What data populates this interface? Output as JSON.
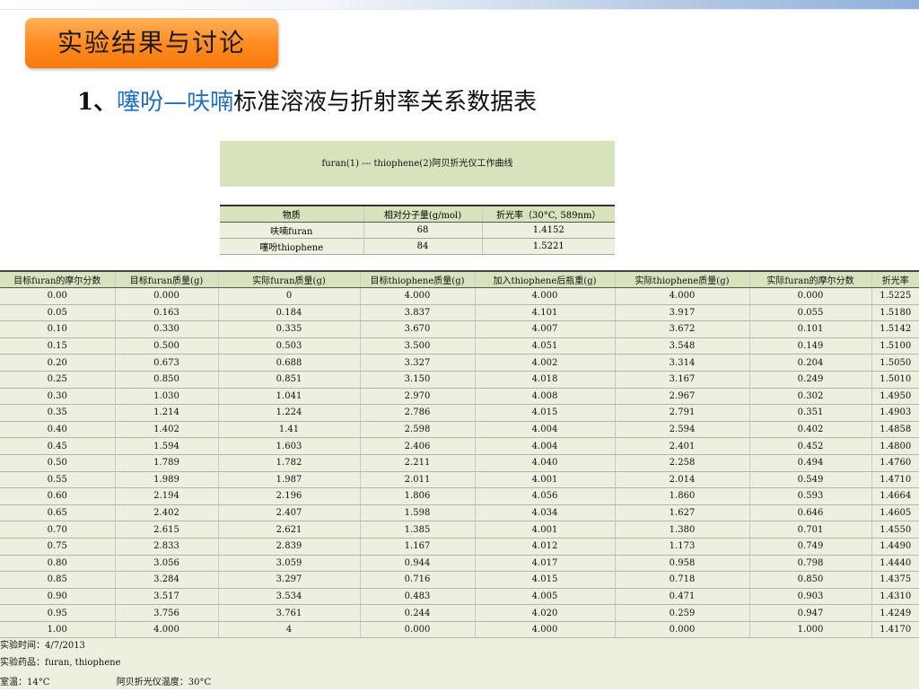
{
  "section_title": "实验结果与讨论",
  "subtitle": {
    "number": "1、",
    "compound_a": "噻吩",
    "dash": "—",
    "compound_b": "呋喃",
    "rest": "标准溶液与折射率关系数据表"
  },
  "curve_title": "furan(1) --- thiophene(2)阿贝折光仪工作曲线",
  "mw_table": {
    "headers": [
      "物质",
      "相对分子量(g/mol)",
      "折光率（30°C, 589nm）"
    ],
    "rows": [
      [
        "呋喃furan",
        "68",
        "1.4152"
      ],
      [
        "噻吩thiophene",
        "84",
        "1.5221"
      ]
    ]
  },
  "data_table": {
    "headers": [
      "目标furan的摩尔分数",
      "目标furan质量(g)",
      "实际furan质量(g)",
      "目标thiophene质量(g)",
      "加入thiophene后瓶重(g)",
      "实际thiophene质量(g)",
      "实际furan的摩尔分数",
      "折光率"
    ],
    "rows": [
      [
        "0.00",
        "0.000",
        "0",
        "4.000",
        "4.000",
        "4.000",
        "0.000",
        "1.5225"
      ],
      [
        "0.05",
        "0.163",
        "0.184",
        "3.837",
        "4.101",
        "3.917",
        "0.055",
        "1.5180"
      ],
      [
        "0.10",
        "0.330",
        "0.335",
        "3.670",
        "4.007",
        "3.672",
        "0.101",
        "1.5142"
      ],
      [
        "0.15",
        "0.500",
        "0.503",
        "3.500",
        "4.051",
        "3.548",
        "0.149",
        "1.5100"
      ],
      [
        "0.20",
        "0.673",
        "0.688",
        "3.327",
        "4.002",
        "3.314",
        "0.204",
        "1.5050"
      ],
      [
        "0.25",
        "0.850",
        "0.851",
        "3.150",
        "4.018",
        "3.167",
        "0.249",
        "1.5010"
      ],
      [
        "0.30",
        "1.030",
        "1.041",
        "2.970",
        "4.008",
        "2.967",
        "0.302",
        "1.4950"
      ],
      [
        "0.35",
        "1.214",
        "1.224",
        "2.786",
        "4.015",
        "2.791",
        "0.351",
        "1.4903"
      ],
      [
        "0.40",
        "1.402",
        "1.41",
        "2.598",
        "4.004",
        "2.594",
        "0.402",
        "1.4858"
      ],
      [
        "0.45",
        "1.594",
        "1.603",
        "2.406",
        "4.004",
        "2.401",
        "0.452",
        "1.4800"
      ],
      [
        "0.50",
        "1.789",
        "1.782",
        "2.211",
        "4.040",
        "2.258",
        "0.494",
        "1.4760"
      ],
      [
        "0.55",
        "1.989",
        "1.987",
        "2.011",
        "4.001",
        "2.014",
        "0.549",
        "1.4710"
      ],
      [
        "0.60",
        "2.194",
        "2.196",
        "1.806",
        "4.056",
        "1.860",
        "0.593",
        "1.4664"
      ],
      [
        "0.65",
        "2.402",
        "2.407",
        "1.598",
        "4.034",
        "1.627",
        "0.646",
        "1.4605"
      ],
      [
        "0.70",
        "2.615",
        "2.621",
        "1.385",
        "4.001",
        "1.380",
        "0.701",
        "1.4550"
      ],
      [
        "0.75",
        "2.833",
        "2.839",
        "1.167",
        "4.012",
        "1.173",
        "0.749",
        "1.4490"
      ],
      [
        "0.80",
        "3.056",
        "3.059",
        "0.944",
        "4.017",
        "0.958",
        "0.798",
        "1.4440"
      ],
      [
        "0.85",
        "3.284",
        "3.297",
        "0.716",
        "4.015",
        "0.718",
        "0.850",
        "1.4375"
      ],
      [
        "0.90",
        "3.517",
        "3.534",
        "0.483",
        "4.005",
        "0.471",
        "0.903",
        "1.4310"
      ],
      [
        "0.95",
        "3.756",
        "3.761",
        "0.244",
        "4.020",
        "0.259",
        "0.947",
        "1.4249"
      ],
      [
        "1.00",
        "4.000",
        "4",
        "0.000",
        "4.000",
        "0.000",
        "1.000",
        "1.4170"
      ]
    ]
  },
  "footer": {
    "time_label": "实验时间：",
    "time_value": "4/7/2013",
    "reagent_label": "实验药品：",
    "reagent_value": "furan, thiophene",
    "room_temp_label": "室温：",
    "room_temp_value": "14°C",
    "abbe_label": "阿贝折光仪温度：",
    "abbe_value": "30°C"
  }
}
